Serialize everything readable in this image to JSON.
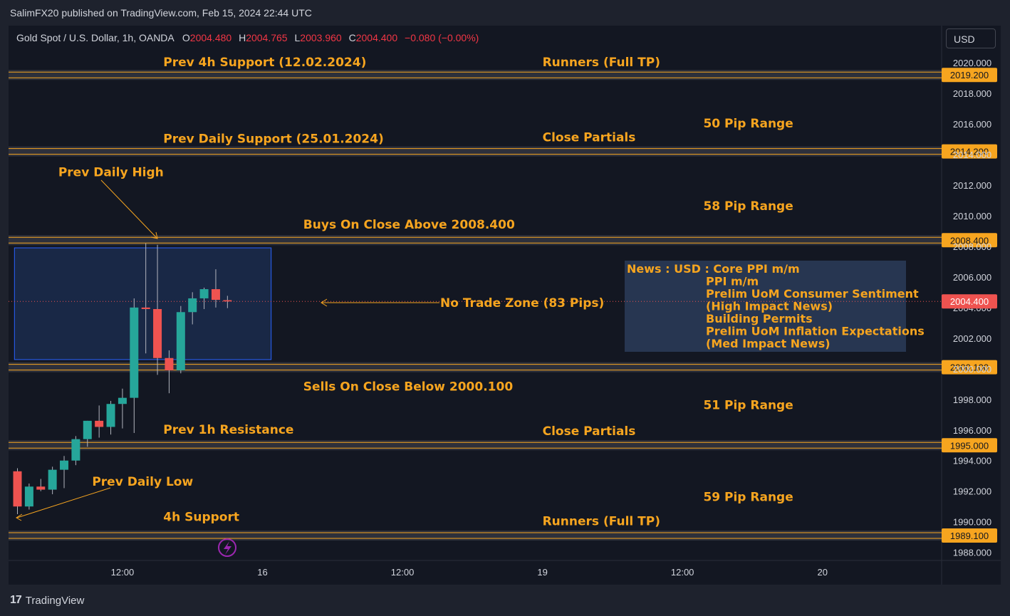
{
  "header": {
    "published": "SalimFX20 published on TradingView.com, Feb 15, 2024 22:44 UTC"
  },
  "ohlc": {
    "symbol": "Gold Spot / U.S. Dollar, 1h, OANDA",
    "o_label": "O",
    "o": "2004.480",
    "h_label": "H",
    "h": "2004.765",
    "l_label": "L",
    "l": "2003.960",
    "c_label": "C",
    "c": "2004.400",
    "change": "−0.080 (−0.00%)"
  },
  "currency": "USD",
  "footer": {
    "brand": "TradingView"
  },
  "colors": {
    "background": "#131722",
    "frame": "#1e222d",
    "text": "#d1d4dc",
    "annotation": "#f7a51f",
    "bull": "#26a69a",
    "bear": "#ef5350",
    "zone_fill": "#1b2b4c",
    "zone_border": "#2962ff",
    "news_box": "#2a3a57"
  },
  "chart_data": {
    "type": "candlestick",
    "title": "",
    "ylim": [
      1987.5,
      2021.0
    ],
    "y_ticks": [
      "2020.000",
      "2018.000",
      "2016.000",
      "2014.000",
      "2012.000",
      "2010.000",
      "2008.000",
      "2006.000",
      "2004.000",
      "2002.000",
      "2000.000",
      "1998.000",
      "1996.000",
      "1994.000",
      "1992.000",
      "1990.000",
      "1988.000"
    ],
    "x_ticks": [
      {
        "label": "12:00",
        "slot": 9
      },
      {
        "label": "16",
        "slot": 21
      },
      {
        "label": "12:00",
        "slot": 33
      },
      {
        "label": "19",
        "slot": 45
      },
      {
        "label": "12:00",
        "slot": 57
      },
      {
        "label": "20",
        "slot": 69
      }
    ],
    "candles": [
      {
        "o": 1993.3,
        "h": 1993.5,
        "l": 1990.5,
        "c": 1991.0
      },
      {
        "o": 1991.0,
        "h": 1992.5,
        "l": 1990.8,
        "c": 1992.3
      },
      {
        "o": 1992.3,
        "h": 1992.8,
        "l": 1992.0,
        "c": 1992.1
      },
      {
        "o": 1992.1,
        "h": 1993.6,
        "l": 1991.8,
        "c": 1993.4
      },
      {
        "o": 1993.4,
        "h": 1994.3,
        "l": 1992.2,
        "c": 1994.0
      },
      {
        "o": 1994.0,
        "h": 1995.6,
        "l": 1993.7,
        "c": 1995.4
      },
      {
        "o": 1995.4,
        "h": 1996.6,
        "l": 1994.9,
        "c": 1996.6
      },
      {
        "o": 1996.6,
        "h": 1997.6,
        "l": 1995.5,
        "c": 1996.2
      },
      {
        "o": 1996.2,
        "h": 1997.9,
        "l": 1995.7,
        "c": 1997.7
      },
      {
        "o": 1997.7,
        "h": 1998.7,
        "l": 1996.1,
        "c": 1998.1
      },
      {
        "o": 1998.1,
        "h": 2004.6,
        "l": 1995.8,
        "c": 2004.0
      },
      {
        "o": 2004.0,
        "h": 2008.2,
        "l": 2001.0,
        "c": 2003.9
      },
      {
        "o": 2003.9,
        "h": 2008.1,
        "l": 1999.6,
        "c": 2000.7
      },
      {
        "o": 2000.7,
        "h": 2001.2,
        "l": 1998.4,
        "c": 1999.9
      },
      {
        "o": 1999.9,
        "h": 2004.1,
        "l": 1999.7,
        "c": 2003.7
      },
      {
        "o": 2003.7,
        "h": 2005.0,
        "l": 2002.9,
        "c": 2004.6
      },
      {
        "o": 2004.6,
        "h": 2005.3,
        "l": 2003.9,
        "c": 2005.2
      },
      {
        "o": 2005.2,
        "h": 2006.5,
        "l": 2004.0,
        "c": 2004.5
      },
      {
        "o": 2004.48,
        "h": 2004.765,
        "l": 2003.96,
        "c": 2004.4
      }
    ],
    "levels": [
      {
        "price": 2019.2,
        "label": "2019.200"
      },
      {
        "price": 2014.2,
        "label": "2014.200"
      },
      {
        "price": 2008.4,
        "label": "2008.400"
      },
      {
        "price": 2000.1,
        "label": "2000.100"
      },
      {
        "price": 1995.0,
        "label": "1995.000"
      },
      {
        "price": 1989.1,
        "label": "1989.100"
      }
    ],
    "current_price": {
      "price": 2004.4,
      "label": "2004.400"
    },
    "no_trade_zone": {
      "top": 2007.9,
      "bottom": 2000.6,
      "slot_start": -0.5,
      "slot_end": 21.5,
      "label": "No Trade Zone (83 Pips)"
    },
    "annotations": [
      {
        "text": "Prev 4h Support (12.02.2024)",
        "slot": 12.5,
        "price": 2020.0
      },
      {
        "text": "Runners (Full TP)",
        "slot": 45.0,
        "price": 2020.0
      },
      {
        "text": "50 Pip Range",
        "slot": 66.5,
        "price": 2016.0,
        "anchor": "end"
      },
      {
        "text": "Prev Daily Support (25.01.2024)",
        "slot": 12.5,
        "price": 2015.0
      },
      {
        "text": "Close Partials",
        "slot": 45.0,
        "price": 2015.1
      },
      {
        "text": "Prev Daily High",
        "slot": 3.5,
        "price": 2012.8
      },
      {
        "text": "58 Pip Range",
        "slot": 66.5,
        "price": 2010.6,
        "anchor": "end"
      },
      {
        "text": "Buys On Close Above 2008.400",
        "slot": 24.5,
        "price": 2009.4
      },
      {
        "text": "Sells On Close Below 2000.100",
        "slot": 24.5,
        "price": 1998.8
      },
      {
        "text": "51 Pip Range",
        "slot": 66.5,
        "price": 1997.6,
        "anchor": "end"
      },
      {
        "text": "Prev 1h Resistance",
        "slot": 12.5,
        "price": 1996.0
      },
      {
        "text": "Close Partials",
        "slot": 45.0,
        "price": 1995.9
      },
      {
        "text": "Prev Daily Low",
        "slot": 6.4,
        "price": 1992.6
      },
      {
        "text": "59 Pip Range",
        "slot": 66.5,
        "price": 1991.6,
        "anchor": "end"
      },
      {
        "text": "4h Support",
        "slot": 12.5,
        "price": 1990.3
      },
      {
        "text": "Runners (Full TP)",
        "slot": 45.0,
        "price": 1990.0
      }
    ],
    "news": {
      "lines": [
        "News : USD : Core PPI m/m",
        "PPI m/m",
        "Prelim UoM Consumer Sentiment",
        "(High Impact News)",
        "Building Permits",
        "Prelim UoM Inflation Expectations",
        "(Med Impact News)"
      ]
    }
  }
}
